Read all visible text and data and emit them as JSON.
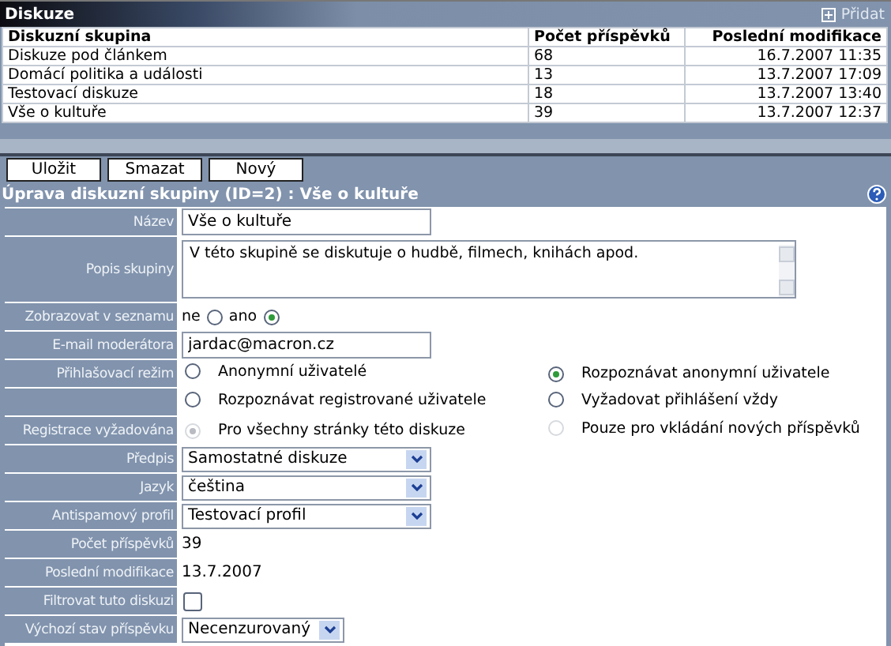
{
  "panel": {
    "title": "Diskuze",
    "add_link": "Přidat"
  },
  "table": {
    "columns": [
      "Diskuzní skupina",
      "Počet příspěvků",
      "Poslední modifikace"
    ],
    "rows": [
      [
        "Diskuze pod článkem",
        "68",
        "16.7.2007 11:35"
      ],
      [
        "Domácí politika a události",
        "13",
        "13.7.2007 17:09"
      ],
      [
        "Testovací diskuze",
        "18",
        "13.7.2007 13:40"
      ],
      [
        "Vše o kultuře",
        "39",
        "13.7.2007 12:37"
      ]
    ]
  },
  "buttons": [
    "Uložit",
    "Smazat",
    "Nový"
  ],
  "form": {
    "title": "Úprava diskuzní skupiny (ID=2) : Vše o kultuře",
    "fields": [
      {
        "kind": "text",
        "label": "Název",
        "value": "Vše o kultuře"
      },
      {
        "kind": "textarea",
        "label": "Popis skupiny",
        "value": "V této skupině se diskutuje o hudbě, filmech, knihách apod."
      },
      {
        "kind": "radio_inline",
        "label": "Zobrazovat v seznamu",
        "options": [
          {
            "label": "ne",
            "selected": false
          },
          {
            "label": "ano",
            "selected": true
          }
        ]
      },
      {
        "kind": "text",
        "label": "E-mail moderátora",
        "value": "jardac@macron.cz"
      },
      {
        "kind": "radio_grid",
        "label": "Přihlašovací režim",
        "options": [
          {
            "label": "Anonymní uživatelé",
            "selected": false,
            "disabled": false
          },
          {
            "label": "Rozpoznávat anonymní uživatele",
            "selected": true,
            "disabled": false
          },
          {
            "label": "Rozpoznávat registrované uživatele",
            "selected": false,
            "disabled": false
          },
          {
            "label": "Vyžadovat přihlášení vždy",
            "selected": false,
            "disabled": false
          }
        ]
      },
      {
        "kind": "radio_grid",
        "label": "Registrace vyžadována",
        "options": [
          {
            "label": "Pro všechny stránky této diskuze",
            "selected": true,
            "disabled": true
          },
          {
            "label": "Pouze pro vkládání nových příspěvků",
            "selected": false,
            "disabled": true
          }
        ]
      },
      {
        "kind": "select",
        "label": "Předpis",
        "value": "Samostatné diskuze"
      },
      {
        "kind": "select",
        "label": "Jazyk",
        "value": "čeština"
      },
      {
        "kind": "select",
        "label": "Antispamový profil",
        "value": "Testovací profil"
      },
      {
        "kind": "static",
        "label": "Počet příspěvků",
        "value": "39"
      },
      {
        "kind": "static",
        "label": "Poslední modifikace",
        "value": "13.7.2007"
      },
      {
        "kind": "checkbox",
        "label": "Filtrovat tuto diskuzi",
        "checked": false
      },
      {
        "kind": "select_small",
        "label": "Výchozí stav příspěvku",
        "value": "Necenzurovaný"
      }
    ]
  }
}
